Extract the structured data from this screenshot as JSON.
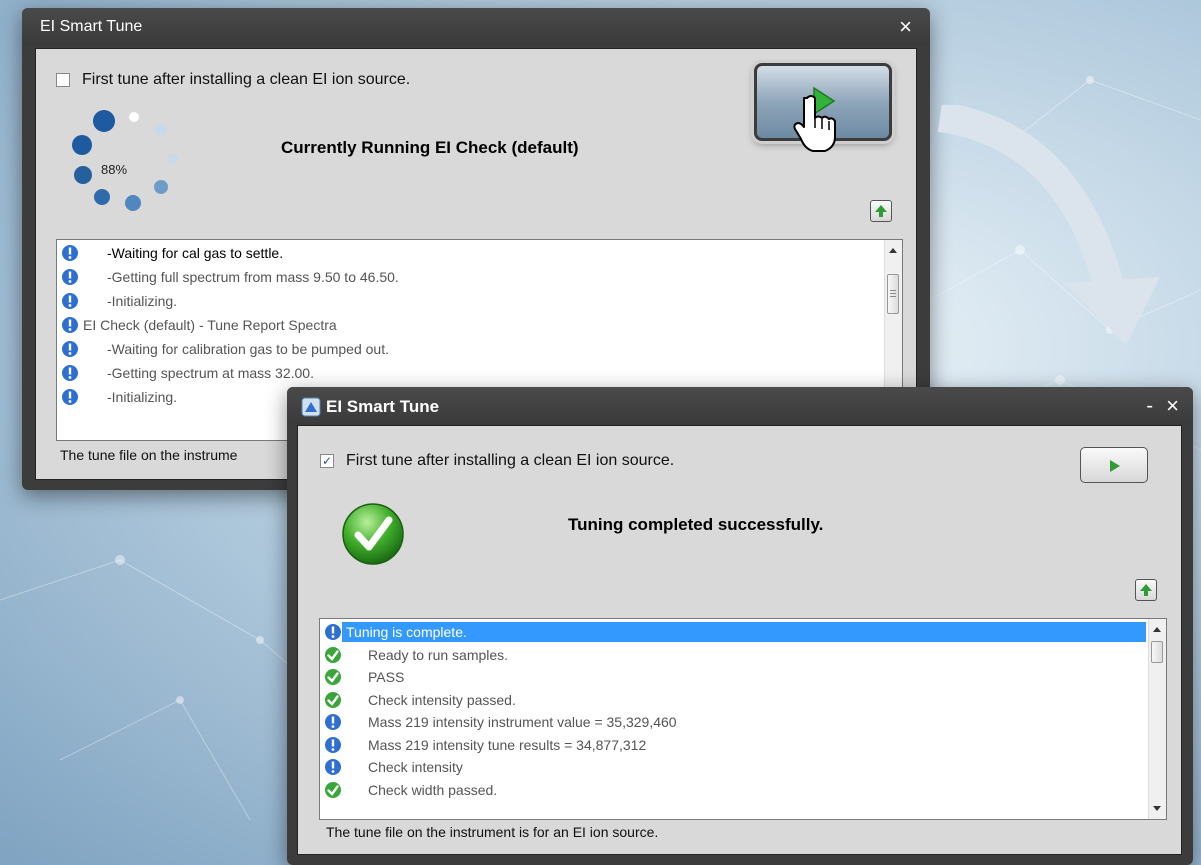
{
  "back_window": {
    "title": "EI Smart Tune",
    "close_glyph": "×",
    "first_tune_label": "First tune after installing a clean EI ion source.",
    "first_tune_checked": false,
    "progress_percent_text": "88%",
    "progress_percent": 88,
    "status_heading": "Currently Running EI Check (default)",
    "log": [
      {
        "icon": "info-icon",
        "text": "-Waiting for cal gas to settle.",
        "dark": true
      },
      {
        "icon": "info-icon",
        "text": "-Getting full spectrum from mass 9.50 to 46.50.",
        "dark": false
      },
      {
        "icon": "info-icon",
        "text": "-Initializing.",
        "dark": false
      },
      {
        "icon": "info-icon",
        "text": "EI Check (default) - Tune Report Spectra",
        "dark": false,
        "outdent": true
      },
      {
        "icon": "info-icon",
        "text": "-Waiting for calibration gas to be pumped out.",
        "dark": false
      },
      {
        "icon": "info-icon",
        "text": "-Getting spectrum at mass 32.00.",
        "dark": false
      },
      {
        "icon": "info-icon",
        "text": "-Initializing.",
        "dark": false
      }
    ],
    "status_bar_text": "The tune file on the instrume"
  },
  "front_window": {
    "title": "EI Smart Tune",
    "minimize_glyph": "-",
    "close_glyph": "×",
    "first_tune_label": "First tune after installing a clean EI ion source.",
    "first_tune_checked": true,
    "check_glyph": "✓",
    "status_heading": "Tuning completed successfully.",
    "log": [
      {
        "icon": "info-icon",
        "text": "Tuning is complete.",
        "selected": true
      },
      {
        "icon": "check-icon",
        "text": "Ready to run samples."
      },
      {
        "icon": "check-icon",
        "text": "PASS"
      },
      {
        "icon": "check-icon",
        "text": "Check intensity passed."
      },
      {
        "icon": "info-icon",
        "text": "Mass 219 intensity instrument value = 35,329,460"
      },
      {
        "icon": "info-icon",
        "text": "Mass 219 intensity tune results = 34,877,312"
      },
      {
        "icon": "info-icon",
        "text": "Check intensity"
      },
      {
        "icon": "check-icon",
        "text": "Check width passed."
      }
    ],
    "status_bar_text": "The tune file on the instrument is for an EI ion source."
  },
  "colors": {
    "selection": "#3399ff",
    "info_blue": "#2f6fd0",
    "check_green": "#3aa53a",
    "window_frame": "#3c3c3c",
    "client_gray": "#d9d9d9"
  }
}
